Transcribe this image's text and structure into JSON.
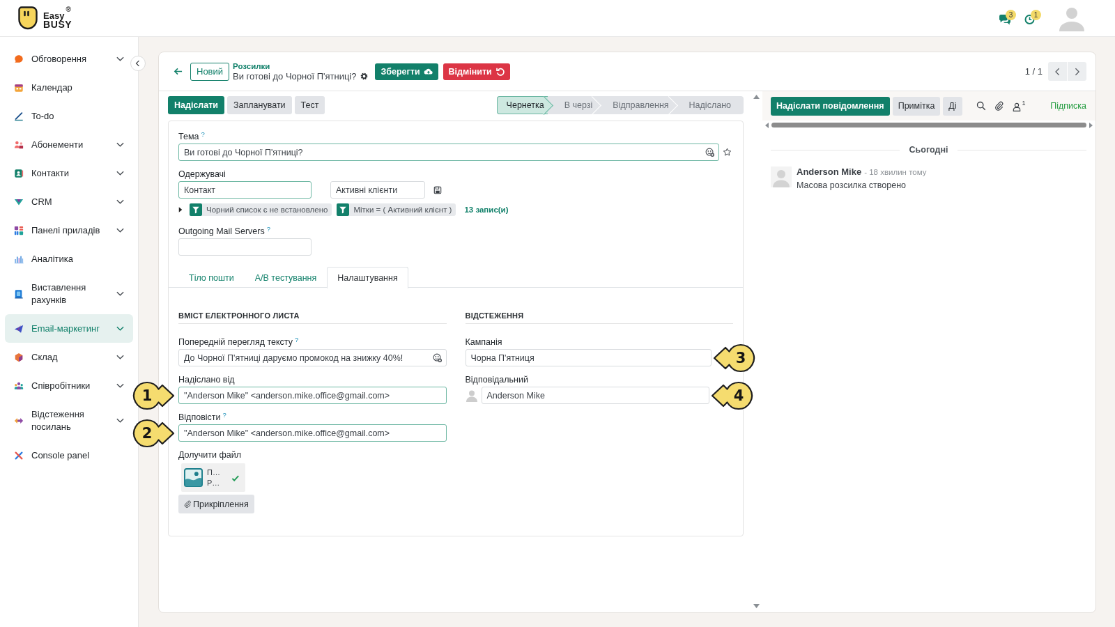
{
  "topbar": {
    "logo": {
      "line1": "Easy",
      "line2": "BUSY",
      "mark": "®"
    },
    "indicators": [
      {
        "kind": "messages",
        "count": "3"
      },
      {
        "kind": "activities",
        "count": "1"
      }
    ]
  },
  "sidebar": {
    "items": [
      {
        "kind": "discuss",
        "label": "Обговорення",
        "expandable": true,
        "selected": false
      },
      {
        "kind": "calendar",
        "label": "Календар",
        "expandable": false,
        "selected": false
      },
      {
        "kind": "todo",
        "label": "To-do",
        "expandable": false,
        "selected": false
      },
      {
        "kind": "subscriptions",
        "label": "Абонементи",
        "expandable": true,
        "selected": false
      },
      {
        "kind": "contacts",
        "label": "Контакти",
        "expandable": true,
        "selected": false
      },
      {
        "kind": "crm",
        "label": "CRM",
        "expandable": true,
        "selected": false
      },
      {
        "kind": "dashboards",
        "label": "Панелі приладів",
        "expandable": true,
        "selected": false
      },
      {
        "kind": "analytics",
        "label": "Аналітика",
        "expandable": false,
        "selected": false
      },
      {
        "kind": "invoicing",
        "label": "Виставлення рахунків",
        "expandable": true,
        "selected": false
      },
      {
        "kind": "email",
        "label": "Email-маркетинг",
        "expandable": true,
        "selected": true
      },
      {
        "kind": "inventory",
        "label": "Склад",
        "expandable": true,
        "selected": false
      },
      {
        "kind": "employees",
        "label": "Співробітники",
        "expandable": true,
        "selected": false
      },
      {
        "kind": "links",
        "label": "Відстеження посилань",
        "expandable": true,
        "selected": false
      },
      {
        "kind": "console",
        "label": "Console panel",
        "expandable": false,
        "selected": false
      }
    ]
  },
  "header": {
    "new_button": "Новий",
    "breadcrumb": "Розсилки",
    "title": "Ви готові до Чорної П'ятниці?",
    "save_button": "Зберегти",
    "discard_button": "Відмінити",
    "pager": "1 / 1"
  },
  "form": {
    "actions": [
      {
        "label": "Надіслати",
        "primary": true
      },
      {
        "label": "Запланувати",
        "primary": false
      },
      {
        "label": "Тест",
        "primary": false
      }
    ],
    "stages": [
      {
        "label": "Чернетка",
        "selected": true
      },
      {
        "label": "В черзі",
        "selected": false
      },
      {
        "label": "Відправлення",
        "selected": false
      },
      {
        "label": "Надіслано",
        "selected": false
      }
    ],
    "subject": {
      "kind": "emoji",
      "label": "Тема",
      "help": "?",
      "value": "Ви готові до Чорної П'ятниці?",
      "required": true
    },
    "recipients": {
      "label": "Одержувачі",
      "model": {
        "value": "Контакт",
        "required": true
      },
      "filter": {
        "value": "Активні клієнти",
        "required": false
      },
      "domain": [
        {
          "label": "Чорний список є не встановлено"
        },
        {
          "label": "Мітки = ( Активний клієнт )"
        }
      ],
      "record_count": "13 запис(и)"
    },
    "mail_server": {
      "label": "Outgoing Mail Servers",
      "help": "?",
      "required": false
    },
    "tabs": [
      {
        "label": "Тіло пошти",
        "selected": false
      },
      {
        "label": "А/В тестування",
        "selected": false
      },
      {
        "label": "Налаштування",
        "selected": true
      }
    ],
    "sections": [
      {
        "title": "ВМІСТ ЕЛЕКТРОННОГО ЛИСТА",
        "fields": [
          {
            "kind": "emoji",
            "label": "Попередній перегляд тексту",
            "help": "?",
            "value": "До Чорної П'ятниці даруємо промокод на знижку 40%!",
            "required": false
          },
          {
            "kind": "text",
            "label": "Надіслано від",
            "value": "\"Anderson Mike\" <anderson.mike.office@gmail.com>",
            "required": true,
            "callout": "1"
          },
          {
            "kind": "text",
            "label": "Відповісти",
            "help": "?",
            "value": "\"Anderson Mike\" <anderson.mike.office@gmail.com>",
            "required": true,
            "callout": "2"
          },
          {
            "kind": "attachments",
            "label": "Долучити файл",
            "files": [
              {
                "name": "П…",
                "type": "P…",
                "uploaded": true
              }
            ],
            "button": "Прикріплення"
          }
        ]
      },
      {
        "title": "ВІДСТЕЖЕННЯ",
        "fields": [
          {
            "kind": "text",
            "label": "Кампанія",
            "value": "Чорна П'ятниця",
            "required": false,
            "callout": "3"
          },
          {
            "kind": "user",
            "label": "Відповідальний",
            "value": "Anderson Mike",
            "required": false,
            "callout": "4"
          }
        ]
      }
    ]
  },
  "chatter": {
    "buttons": [
      {
        "label": "Надіслати повідомлення",
        "primary": true
      },
      {
        "label": "Примітка",
        "primary": false
      },
      {
        "label": "Ді",
        "primary": false
      }
    ],
    "followers": "1",
    "follow": "Підписка",
    "date": "Сьогодні",
    "messages": [
      {
        "author": "Anderson Mike",
        "time": "- 18 хвилин тому",
        "body": "Масова розсилка створено"
      }
    ]
  }
}
